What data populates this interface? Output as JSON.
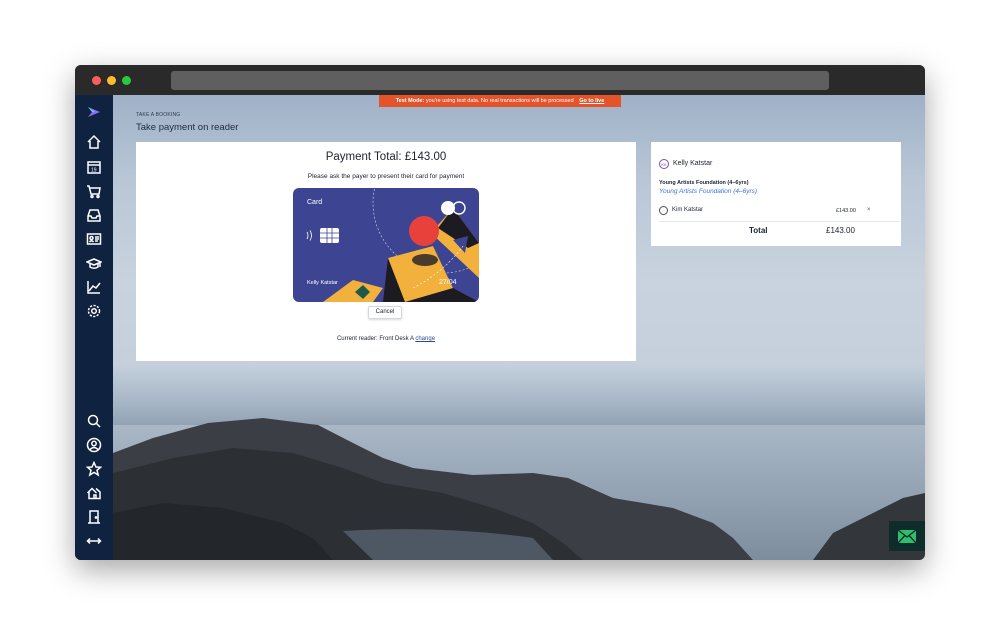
{
  "test_banner": {
    "mode_label": "Test Mode:",
    "message": "you're using test data. No real transactions will be processed",
    "link": "Go to live"
  },
  "breadcrumb": "TAKE A BOOKING",
  "page_title": "Take payment on reader",
  "payment": {
    "total_text": "Payment Total: £143.00",
    "instruction": "Please ask the payer to present their card for payment",
    "card": {
      "label": "Card",
      "holder": "Kelly Katstar",
      "expiry": "27/04"
    },
    "cancel_label": "Cancel",
    "reader_prefix": "Current reader: Front Desk A",
    "reader_change": "change"
  },
  "summary": {
    "avatar_initials": "KK",
    "customer_name": "Kelly Katstar",
    "course_title": "Young Artists Foundation (4–6yrs)",
    "course_link": "Young Artists Foundation (4–6yrs)",
    "attendee": "Kim Katstar",
    "line_price": "£143.00",
    "remove_symbol": "×",
    "total_label": "Total",
    "total_value": "£143.00"
  },
  "sidebar_icons": [
    "logo-icon",
    "home-icon",
    "calendar-icon",
    "cart-icon",
    "inbox-icon",
    "contact-card-icon",
    "graduation-cap-icon",
    "chart-icon",
    "gear-icon",
    "search-icon",
    "user-icon",
    "star-icon",
    "house-icon",
    "door-icon",
    "resize-icon"
  ],
  "colors": {
    "sidebar": "#0f2240",
    "banner": "#e4542b",
    "card_bg": "#3d4592",
    "card_accent": "#f2b13c",
    "link": "#3d72d6"
  }
}
